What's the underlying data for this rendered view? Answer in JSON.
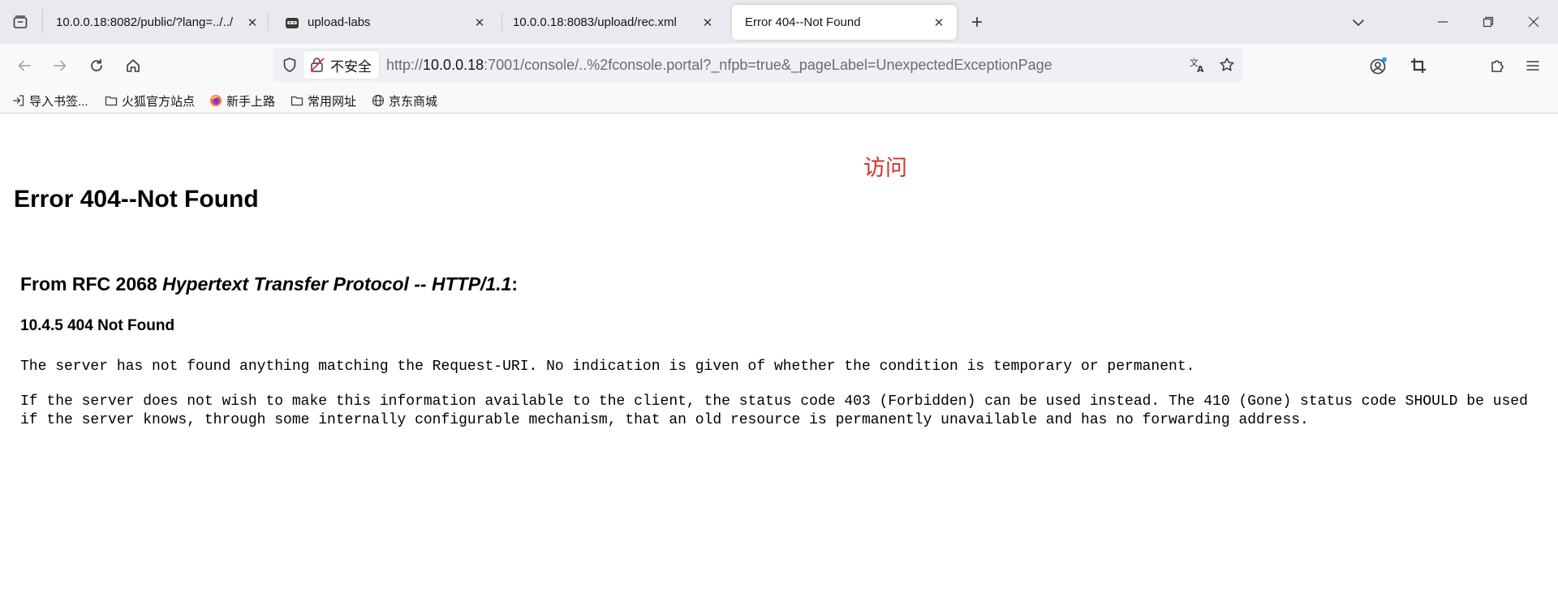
{
  "tabs": [
    {
      "title": "10.0.0.18:8082/public/?lang=../../",
      "active": false,
      "has_favicon": false
    },
    {
      "title": "upload-labs",
      "active": false,
      "has_favicon": true,
      "favicon": "ninja-icon"
    },
    {
      "title": "10.0.0.18:8083/upload/rec.xml",
      "active": false,
      "has_favicon": false
    },
    {
      "title": "Error 404--Not Found",
      "active": true,
      "has_favicon": false
    }
  ],
  "navbar": {
    "security_label": "不安全",
    "url_prefix": "http://",
    "url_host": "10.0.0.18",
    "url_rest": ":7001/console/..%2fconsole.portal?_nfpb=true&_pageLabel=UnexpectedExceptionPage"
  },
  "bookmarks": [
    {
      "label": "导入书签...",
      "icon": "import-icon"
    },
    {
      "label": "火狐官方站点",
      "icon": "folder-icon"
    },
    {
      "label": "新手上路",
      "icon": "firefox-icon"
    },
    {
      "label": "常用网址",
      "icon": "folder-icon"
    },
    {
      "label": "京东商城",
      "icon": "globe-icon"
    }
  ],
  "page": {
    "annotation": "访问",
    "error_title": "Error 404--Not Found",
    "rfc_prefix": "From RFC 2068 ",
    "rfc_title": "Hypertext Transfer Protocol -- HTTP/1.1",
    "rfc_suffix": ":",
    "section": "10.4.5 404 Not Found",
    "paragraph1": "The server has not found anything matching the Request-URI. No indication is given of whether the condition is temporary or permanent.",
    "paragraph2": "If the server does not wish to make this information available to the client, the status code 403 (Forbidden) can be used instead. The 410 (Gone) status code SHOULD be used if the server knows, through some internally configurable mechanism, that an old resource is permanently unavailable and has no forwarding address."
  },
  "colors": {
    "annotation": "#d9302a",
    "tabstrip_bg": "#eae9ee",
    "toolbar_bg": "#f9f9fb",
    "account_badge": "#2d9cf0"
  }
}
